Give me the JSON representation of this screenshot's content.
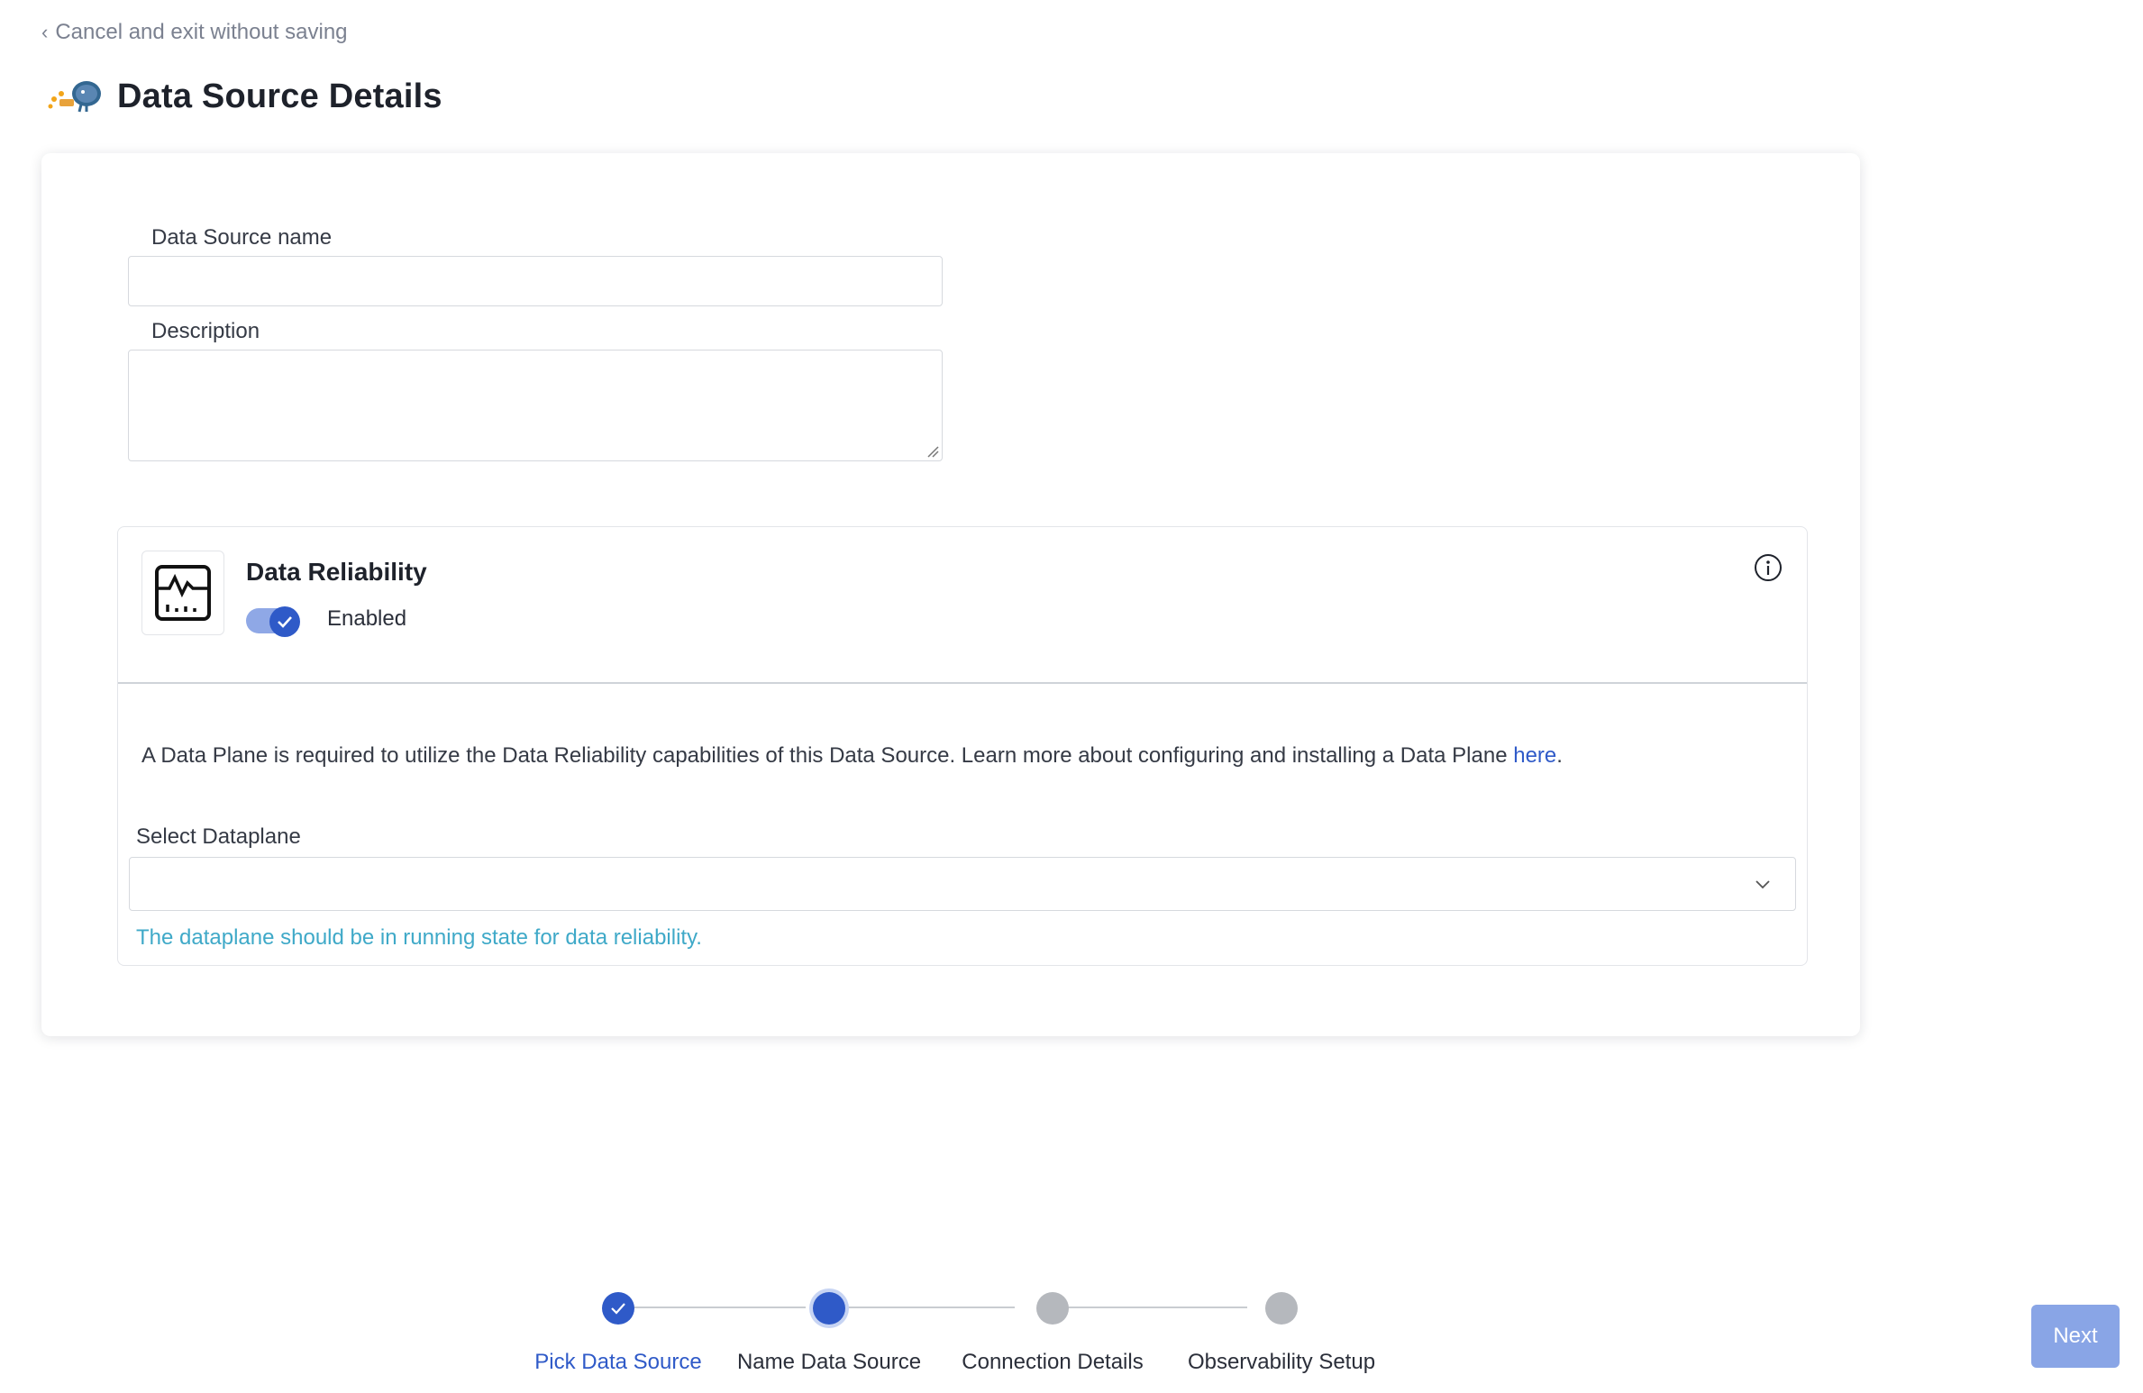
{
  "header": {
    "back_label": "Cancel and exit without saving",
    "title": "Data Source Details",
    "logo_icon": "postgres-elephant-icon"
  },
  "form": {
    "name_label": "Data Source name",
    "name_value": "",
    "description_label": "Description",
    "description_value": ""
  },
  "reliability": {
    "title": "Data Reliability",
    "toggle_label": "Enabled",
    "enabled": true,
    "description": "A Data Plane is required to utilize the Data Reliability capabilities of this Data Source. Learn more about configuring and installing a Data Plane ",
    "link_text": "here",
    "trailing": ".",
    "select_label": "Select Dataplane",
    "select_value": "",
    "hint": "The dataplane should be in running state for data reliability."
  },
  "stepper": {
    "steps": [
      {
        "label": "Pick Data Source",
        "status": "done"
      },
      {
        "label": "Name Data Source",
        "status": "current"
      },
      {
        "label": "Connection Details",
        "status": "pending"
      },
      {
        "label": "Observability Setup",
        "status": "pending"
      }
    ]
  },
  "footer": {
    "next_label": "Next"
  },
  "colors": {
    "accent": "#2f5ac8",
    "accent_light": "#89a5e6",
    "hint": "#3fa9c8",
    "pending": "#b5b8bd"
  }
}
